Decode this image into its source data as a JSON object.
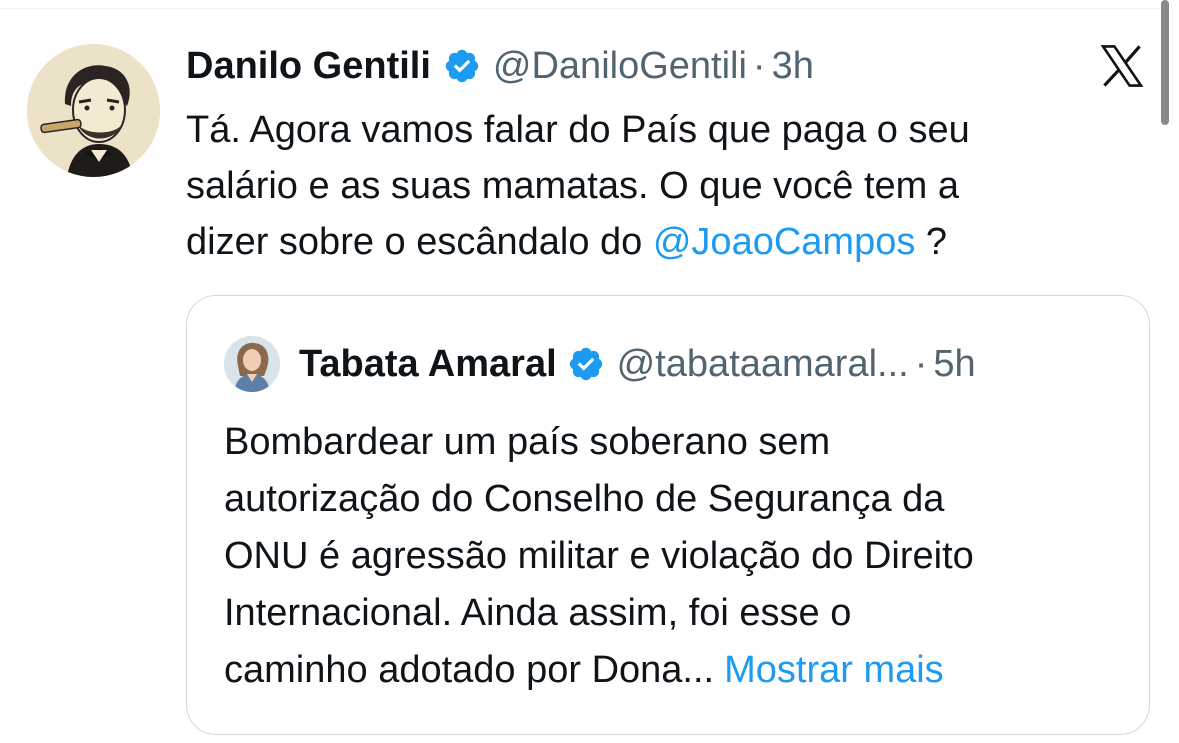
{
  "tweet": {
    "author_name": "Danilo Gentili",
    "author_handle": "@DaniloGentili",
    "separator": "·",
    "time": "3h",
    "text_line1": "Tá. Agora vamos falar do País que paga o seu",
    "text_line2": "salário e as suas mamatas. O que você tem a",
    "text_line3_prefix": "dizer sobre o escândalo do",
    "mention": "@JoaoCampos",
    "text_line3_suffix": " ?"
  },
  "quoted_tweet": {
    "author_name": "Tabata Amaral",
    "author_handle": "@tabataamaral...",
    "separator": "·",
    "time": "5h",
    "line1": "Bombardear um país soberano sem",
    "line2": "autorização do Conselho de Segurança da",
    "line3": "ONU é agressão militar e violação do Direito",
    "line4": "Internacional. Ainda assim, foi esse o",
    "line5": "caminho adotado por Dona...",
    "show_more": "Mostrar mais"
  },
  "colors": {
    "link": "#1d9bf0",
    "verified": "#1d9bf0",
    "secondary_text": "#536471",
    "border": "#cfd9de"
  },
  "icons": [
    "verified-badge-icon",
    "x-logo-icon"
  ]
}
